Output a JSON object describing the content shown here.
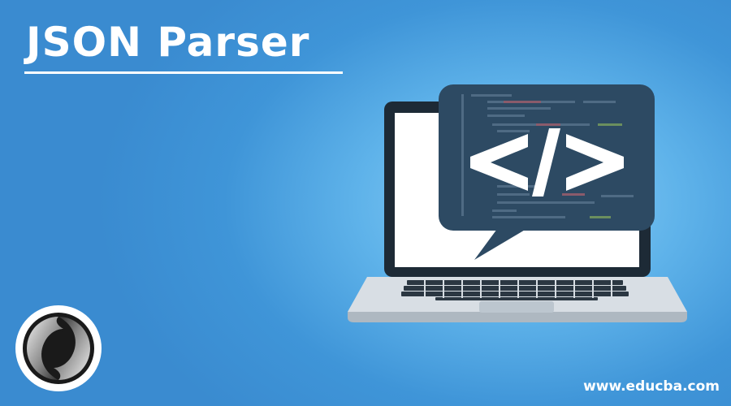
{
  "title": "JSON Parser",
  "website": "www.educba.com",
  "icons": {
    "code_bubble": "code-tag-icon",
    "laptop": "laptop-icon",
    "logo": "json-logo-icon"
  },
  "colors": {
    "background": "#4aa3e0",
    "bubble": "#2d4a63",
    "text": "#ffffff"
  }
}
